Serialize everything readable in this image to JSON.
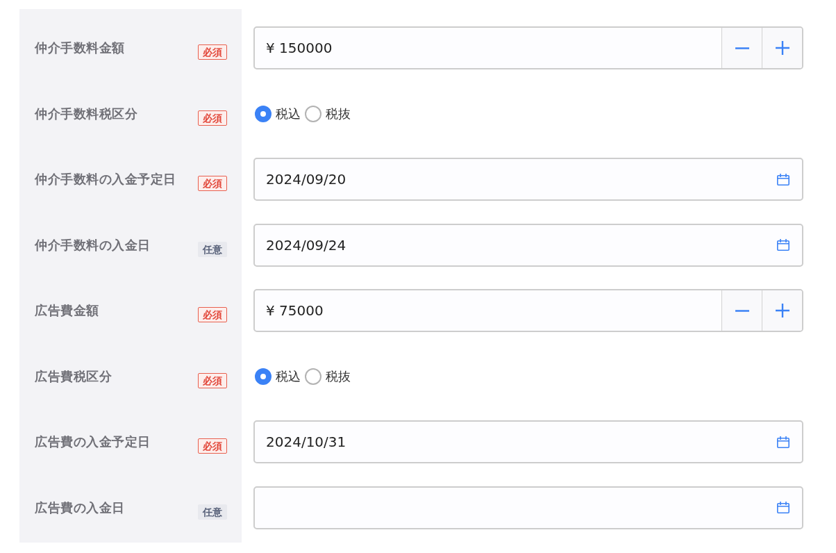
{
  "fields": [
    {
      "label": "仲介手数料金額",
      "badge": {
        "kind": "required",
        "text": "必須"
      },
      "kind": "amount",
      "value": "¥ 150000"
    },
    {
      "label": "仲介手数料税区分",
      "badge": {
        "kind": "required",
        "text": "必須"
      },
      "kind": "radio",
      "options": [
        {
          "label": "税込",
          "selected": true
        },
        {
          "label": "税抜",
          "selected": false
        }
      ]
    },
    {
      "label": "仲介手数料の入金予定日",
      "badge": {
        "kind": "required",
        "text": "必須"
      },
      "kind": "date",
      "value": "2024/09/20"
    },
    {
      "label": "仲介手数料の入金日",
      "badge": {
        "kind": "optional",
        "text": "任意"
      },
      "kind": "date",
      "value": "2024/09/24"
    },
    {
      "label": "広告費金額",
      "badge": {
        "kind": "required",
        "text": "必須"
      },
      "kind": "amount",
      "value": "¥ 75000"
    },
    {
      "label": "広告費税区分",
      "badge": {
        "kind": "required",
        "text": "必須"
      },
      "kind": "radio",
      "options": [
        {
          "label": "税込",
          "selected": true
        },
        {
          "label": "税抜",
          "selected": false
        }
      ]
    },
    {
      "label": "広告費の入金予定日",
      "badge": {
        "kind": "required",
        "text": "必須"
      },
      "kind": "date",
      "value": "2024/10/31"
    },
    {
      "label": "広告費の入金日",
      "badge": {
        "kind": "optional",
        "text": "任意"
      },
      "kind": "date"
    }
  ]
}
